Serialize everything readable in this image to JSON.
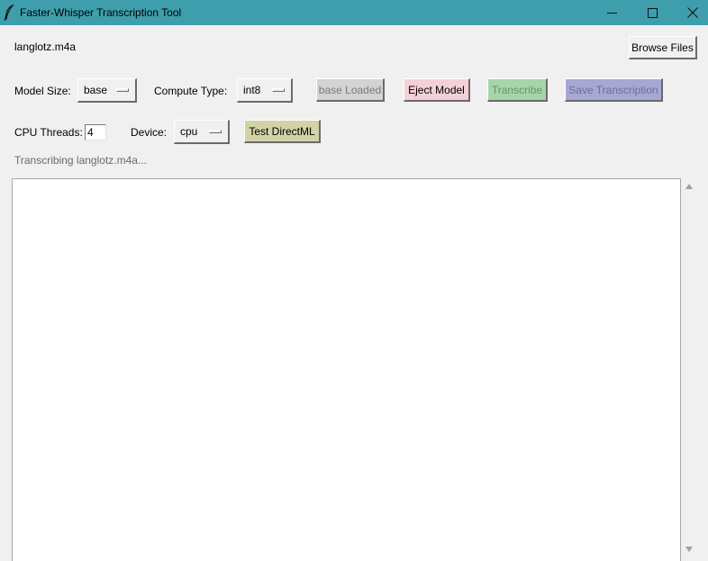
{
  "window": {
    "title": "Faster-Whisper Transcription Tool",
    "icon": "feather-icon"
  },
  "file": {
    "name": "langlotz.m4a",
    "browse_label": "Browse Files"
  },
  "model": {
    "size_label": "Model Size:",
    "size_value": "base",
    "compute_label": "Compute Type:",
    "compute_value": "int8",
    "loaded_label": "base Loaded",
    "eject_label": "Eject Model",
    "transcribe_label": "Transcribe",
    "save_label": "Save Transcription"
  },
  "settings": {
    "threads_label": "CPU Threads:",
    "threads_value": "4",
    "device_label": "Device:",
    "device_value": "cpu",
    "test_label": "Test DirectML"
  },
  "status": "Transcribing langlotz.m4a...",
  "colors": {
    "titlebar": "#3e9eac",
    "eject": "#f3d1d6",
    "transcribe": "#a6d6a8",
    "save": "#a7a7d6",
    "test": "#d2d2a6",
    "loaded": "#d3d3d3"
  }
}
